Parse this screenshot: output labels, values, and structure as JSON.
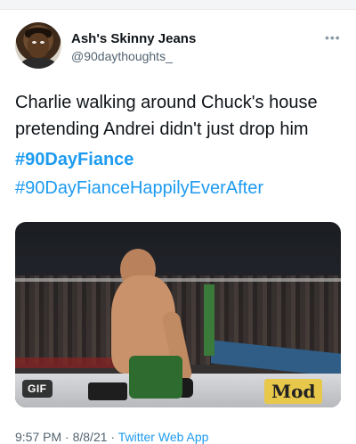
{
  "tweet": {
    "display_name": "Ash's Skinny Jeans",
    "handle": "@90daythoughts_",
    "more_icon": "more-dots-icon",
    "text_line1": "Charlie walking around Chuck's house",
    "text_line2": "pretending Andrei didn't just drop him",
    "hashtag1": "#90DayFiance",
    "hashtag2": "#90DayFianceHappilyEverAfter",
    "media": {
      "badge": "GIF",
      "sign_text": "Mod"
    },
    "time": "9:57 PM",
    "date": "8/8/21",
    "separator": "·",
    "source": "Twitter Web App"
  },
  "colors": {
    "link": "#1d9bf0",
    "text": "#0f1419",
    "secondary": "#536471"
  }
}
